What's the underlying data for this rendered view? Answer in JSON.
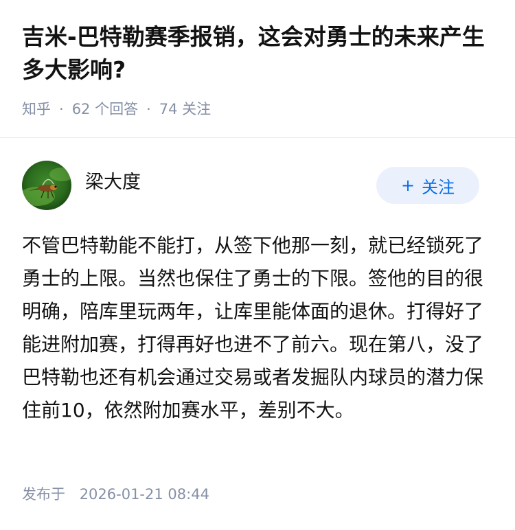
{
  "question": {
    "title": "吉米-巴特勒赛季报销，这会对勇士的未来产生多大影响?",
    "source": "知乎",
    "answers_count": "62 个回答",
    "followers_count": "74 关注"
  },
  "author": {
    "name": "梁大度",
    "follow_label": "关注",
    "follow_icon": "plus-icon"
  },
  "answer": {
    "content": "不管巴特勒能不能打，从签下他那一刻，就已经锁死了勇士的上限。当然也保住了勇士的下限。签他的目的很明确，陪库里玩两年，让库里能体面的退休。打得好了能进附加赛，打得再好也进不了前六。现在第八，没了巴特勒也还有机会通过交易或者发掘队内球员的潜力保住前10，依然附加赛水平，差别不大。",
    "published_label": "发布于",
    "published_time": "2026-01-21 08:44"
  },
  "colors": {
    "meta_gray": "#8590a6",
    "accent_blue": "#056de8",
    "follow_bg": "#ebf1fc"
  }
}
